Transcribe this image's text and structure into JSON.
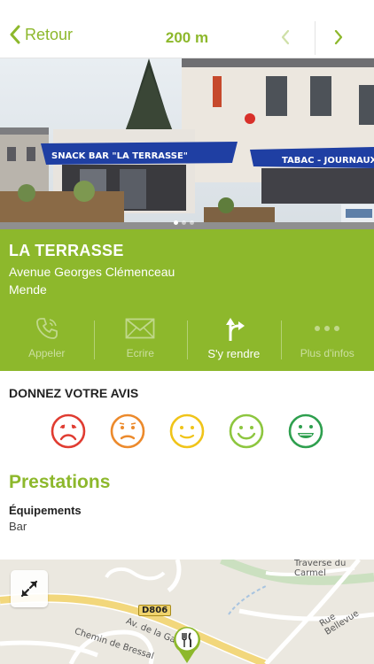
{
  "colors": {
    "accent": "#8db82c"
  },
  "nav": {
    "back_label": "Retour",
    "distance": "200 m",
    "prev_icon": "chevron-left-icon",
    "next_icon": "chevron-right-icon"
  },
  "gallery": {
    "count": 3,
    "active_index": 0
  },
  "poi": {
    "name": "LA TERRASSE",
    "address_line1": "Avenue Georges Clémenceau",
    "address_line2": "Mende",
    "photo_sign_left": "SNACK BAR \"LA TERRASSE\"",
    "photo_sign_right": "TABAC - JOURNAUX"
  },
  "actions": [
    {
      "label": "Appeler",
      "icon": "phone-icon"
    },
    {
      "label": "Ecrire",
      "icon": "envelope-icon"
    },
    {
      "label": "S'y rendre",
      "icon": "directions-icon"
    },
    {
      "label": "Plus d'infos",
      "icon": "more-icon"
    }
  ],
  "avis": {
    "title": "DONNEZ VOTRE AVIS",
    "ratings": [
      {
        "name": "very-bad",
        "color": "#e03c31"
      },
      {
        "name": "bad",
        "color": "#ec8a2c"
      },
      {
        "name": "neutral",
        "color": "#f0c419"
      },
      {
        "name": "good",
        "color": "#8dc63f"
      },
      {
        "name": "very-good",
        "color": "#2e9f4e"
      }
    ]
  },
  "prestations": {
    "title": "Prestations",
    "equipements_label": "Équipements",
    "equipements_value": "Bar"
  },
  "map": {
    "road_badge": "D806",
    "label_traverse": "Traverse du Carmel",
    "label_bellevue": "Rue Bellevue",
    "label_avenue": "Av. de la Gare",
    "label_chemin": "Chemin de Bressal",
    "pin_icon": "restaurant-pin-icon",
    "expand_icon": "expand-icon"
  }
}
